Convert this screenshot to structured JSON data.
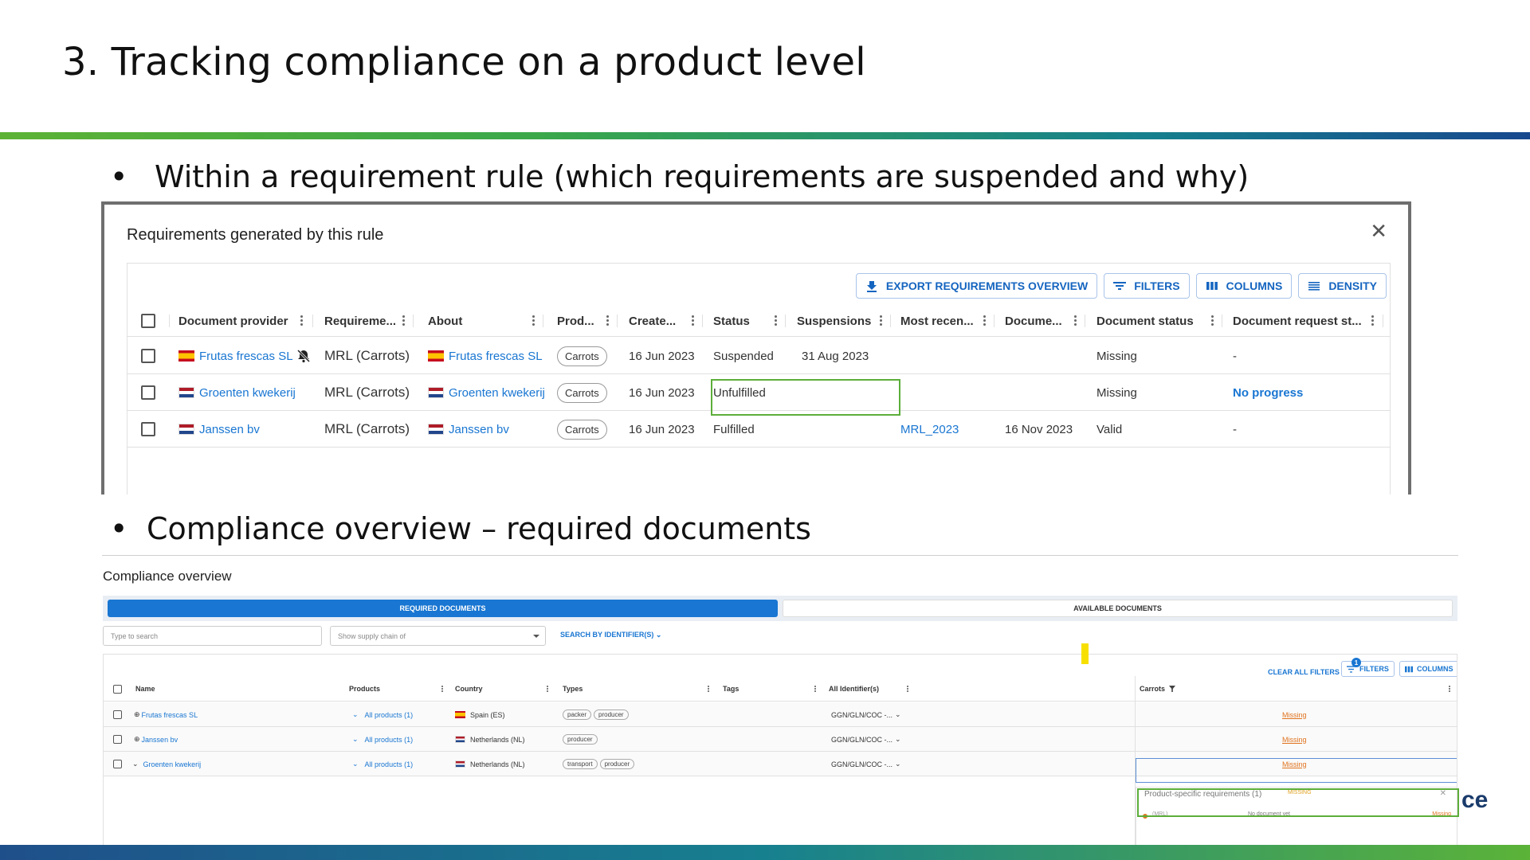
{
  "slide": {
    "title": "3. Tracking compliance on a product level",
    "bullet1": "Within a requirement rule (which requirements are suspended and why)",
    "bullet2": "Compliance overview – required documents",
    "bullet_char": "•",
    "brand_fragment": "ce",
    "colors": {
      "band_start": "#5cb235",
      "band_end": "#17488e",
      "highlight": "#5cae3a",
      "link": "#1976d2",
      "missing": "#e0731f"
    }
  },
  "requirements_panel": {
    "title": "Requirements generated by this rule",
    "close_icon": "close-icon",
    "toolbar": {
      "export": "EXPORT REQUIREMENTS OVERVIEW",
      "filters": "FILTERS",
      "columns": "COLUMNS",
      "density": "DENSITY"
    },
    "columns": [
      "Document provider",
      "Requireme...",
      "About",
      "Prod...",
      "Create...",
      "Status",
      "Suspensions",
      "Most recen...",
      "Docume...",
      "Document status",
      "Document request st..."
    ],
    "rows": [
      {
        "provider": "Frutas frescas SL",
        "provider_flag": "es",
        "muted": true,
        "requirement": "MRL (Carrots)",
        "about": "Frutas frescas SL",
        "about_flag": "es",
        "product": "Carrots",
        "created": "16 Jun 2023",
        "status": "Suspended",
        "suspensions": "31 Aug 2023",
        "most_recent": "",
        "document_date": "",
        "document_status": "Missing",
        "request_status": "-"
      },
      {
        "provider": "Groenten kwekerij",
        "provider_flag": "nl",
        "muted": false,
        "requirement": "MRL (Carrots)",
        "about": "Groenten kwekerij",
        "about_flag": "nl",
        "product": "Carrots",
        "created": "16 Jun 2023",
        "status": "Unfulfilled",
        "suspensions": "",
        "most_recent": "",
        "document_date": "",
        "document_status": "Missing",
        "request_status": "No progress"
      },
      {
        "provider": "Janssen bv",
        "provider_flag": "nl",
        "muted": false,
        "requirement": "MRL (Carrots)",
        "about": "Janssen bv",
        "about_flag": "nl",
        "product": "Carrots",
        "created": "16 Jun 2023",
        "status": "Fulfilled",
        "suspensions": "",
        "most_recent": "MRL_2023",
        "document_date": "16 Nov 2023",
        "document_status": "Valid",
        "request_status": "-"
      }
    ]
  },
  "compliance": {
    "title": "Compliance overview",
    "tabs": {
      "required": "REQUIRED DOCUMENTS",
      "available": "AVAILABLE DOCUMENTS"
    },
    "search_placeholder": "Type to search",
    "chain_placeholder": "Show supply chain of",
    "identifier_button": "SEARCH BY IDENTIFIER(S)",
    "clear_filters": "CLEAR ALL FILTERS",
    "filters": "FILTERS",
    "filters_count": "1",
    "columns_btn": "COLUMNS",
    "columns": [
      "Name",
      "Products",
      "Country",
      "Types",
      "Tags",
      "All Identifier(s)",
      "Carrots"
    ],
    "rows": [
      {
        "name": "Frutas frescas SL",
        "products": "All products (1)",
        "country": "Spain (ES)",
        "flag": "es",
        "types": [
          "packer",
          "producer"
        ],
        "identifier": "GGN/GLN/COC -...",
        "carrots": "Missing"
      },
      {
        "name": "Janssen bv",
        "products": "All products (1)",
        "country": "Netherlands (NL)",
        "flag": "nl",
        "types": [
          "producer"
        ],
        "identifier": "GGN/GLN/COC -...",
        "carrots": "Missing"
      },
      {
        "name": "Groenten kwekerij",
        "products": "All products (1)",
        "country": "Netherlands (NL)",
        "flag": "nl",
        "types": [
          "transport",
          "producer"
        ],
        "identifier": "GGN/GLN/COC -...",
        "carrots": "Missing"
      }
    ],
    "popup": {
      "title": "Product-specific requirements (1)",
      "title_status": "MISSING",
      "row_label": "(MRL)",
      "row_doc": "No document yet",
      "row_status": "Missing"
    }
  }
}
